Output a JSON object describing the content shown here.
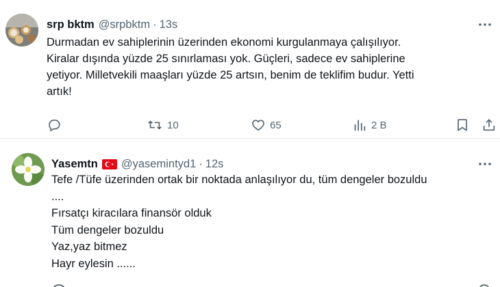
{
  "tweets": [
    {
      "name": "srp bktm",
      "handle": "@srpbktm",
      "time": "13s",
      "dot": "·",
      "text_lines": [
        "Durmadan ev sahiplerinin üzerinden ekonomi kurgulanmaya çalışılıyor.",
        "Kiralar dışında yüzde 25 sınırlaması yok. Güçleri, sadece ev sahiplerine",
        "yetiyor. Milletvekili maaşları yüzde 25 artsın, benim de teklifim budur. Yetti",
        "artık!"
      ],
      "actions": {
        "reply": {
          "icon": "reply-icon",
          "count": ""
        },
        "retweet": {
          "icon": "retweet-icon",
          "count": "10"
        },
        "like": {
          "icon": "heart-icon",
          "count": "65"
        },
        "views": {
          "icon": "views-icon",
          "count": "2 B"
        },
        "bookmark": {
          "icon": "bookmark-icon"
        },
        "share": {
          "icon": "share-icon"
        }
      }
    },
    {
      "name": "Yasemtn",
      "handle": "@yasemintyd1",
      "time": "12s",
      "dot": "·",
      "flag": "turkey-flag",
      "text_lines": [
        "Tefe /Tüfe üzerinden ortak bir noktada anlaşılıyor du, tüm dengeler bozuldu",
        "....",
        "Fırsatçı kiracılara finansör olduk",
        "Tüm dengeler bozuldu",
        "Yaz,yaz bitmez",
        "Hayr eylesin ......"
      ]
    }
  ],
  "colors": {
    "text": "#0f1419",
    "muted": "#536471",
    "divider": "#e6e9ec",
    "flag_red": "#e30a17"
  }
}
